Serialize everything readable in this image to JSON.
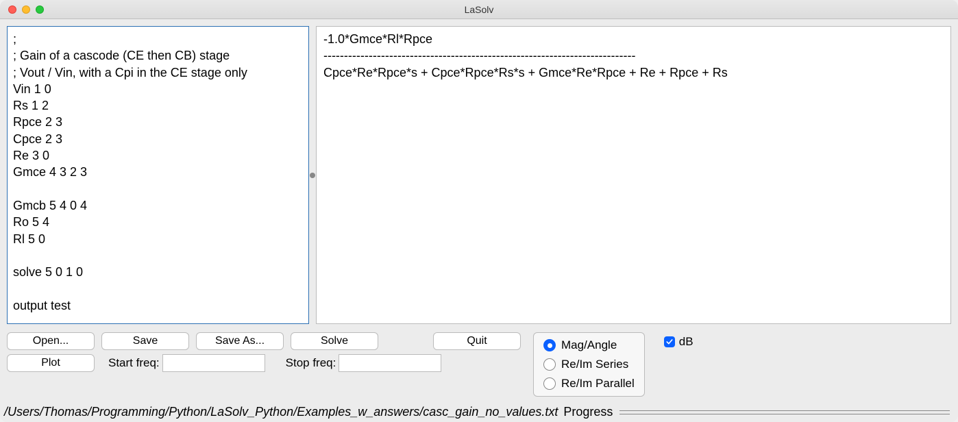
{
  "window": {
    "title": "LaSolv"
  },
  "editor": {
    "content": ";\n; Gain of a cascode (CE then CB) stage\n; Vout / Vin, with a Cpi in the CE stage only\nVin 1 0\nRs 1 2\nRpce 2 3\nCpce 2 3\nRe 3 0\nGmce 4 3 2 3\n\nGmcb 5 4 0 4\nRo 5 4\nRl 5 0\n\nsolve 5 0 1 0\n\noutput test"
  },
  "output": {
    "content": "-1.0*Gmce*Rl*Rpce\n----------------------------------------------------------------------------\nCpce*Re*Rpce*s + Cpce*Rpce*Rs*s + Gmce*Re*Rpce + Re + Rpce + Rs"
  },
  "buttons": {
    "open": "Open...",
    "save": "Save",
    "saveas": "Save As...",
    "solve": "Solve",
    "quit": "Quit",
    "plot": "Plot"
  },
  "freq": {
    "start_label": "Start freq:",
    "stop_label": "Stop freq:",
    "start_value": "",
    "stop_value": ""
  },
  "radios": {
    "mag_angle": "Mag/Angle",
    "reim_series": "Re/Im Series",
    "reim_parallel": "Re/Im Parallel",
    "selected": "mag_angle"
  },
  "checkbox": {
    "db_label": "dB",
    "db_checked": true
  },
  "status": {
    "path": "/Users/Thomas/Programming/Python/LaSolv_Python/Examples_w_answers/casc_gain_no_values.txt",
    "progress_label": "Progress"
  }
}
